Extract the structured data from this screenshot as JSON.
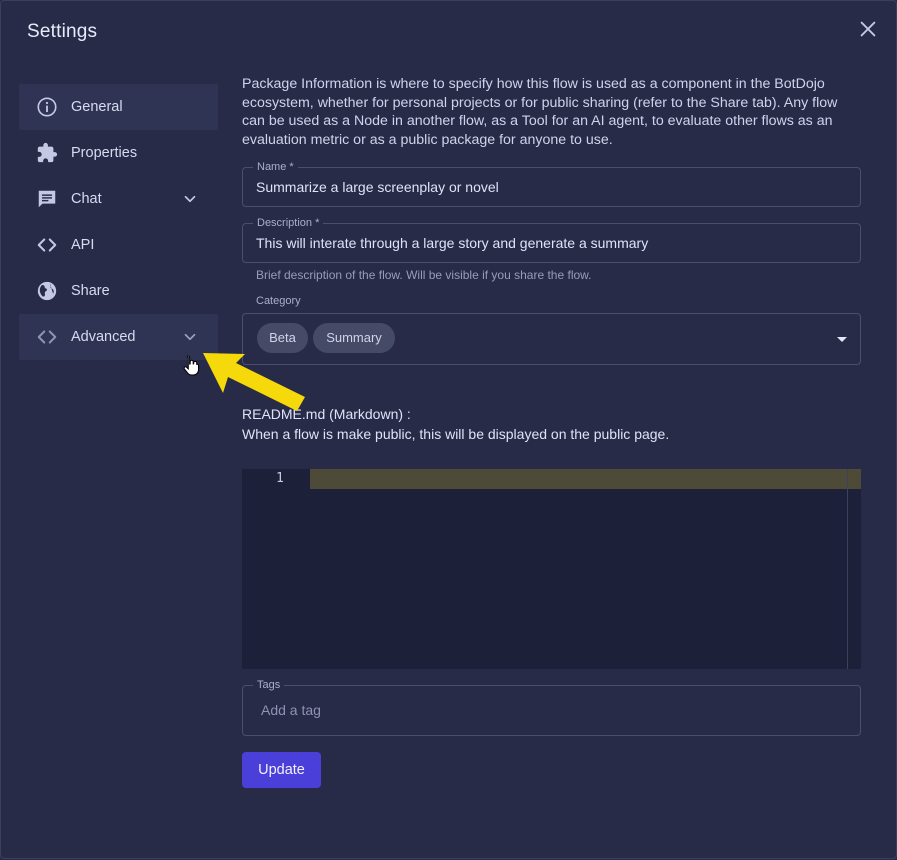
{
  "dialog": {
    "title": "Settings"
  },
  "sidebar": {
    "items": [
      {
        "label": "General",
        "icon": "info-icon"
      },
      {
        "label": "Properties",
        "icon": "puzzle-icon"
      },
      {
        "label": "Chat",
        "icon": "chat-icon",
        "expandable": true
      },
      {
        "label": "API",
        "icon": "code-icon"
      },
      {
        "label": "Share",
        "icon": "globe-icon"
      },
      {
        "label": "Advanced",
        "icon": "code-icon",
        "expandable": true
      }
    ]
  },
  "content": {
    "intro": "Package Information is where to specify how this flow is used as a component in the BotDojo ecosystem, whether for personal projects or for public sharing (refer to the Share tab). Any flow can be used as a Node in another flow, as a Tool for an AI agent, to evaluate other flows as an evaluation metric or as a public package for anyone to use.",
    "name": {
      "label": "Name *",
      "value": "Summarize a large screenplay or novel"
    },
    "description": {
      "label": "Description *",
      "value": "This will interate through a large story and generate a summary",
      "helper": "Brief description of the flow. Will be visible if you share the flow."
    },
    "category": {
      "label": "Category",
      "chips": [
        "Beta",
        "Summary"
      ]
    },
    "readme": {
      "heading": "README.md (Markdown) :",
      "description": "When a flow is make public, this will be displayed on the public page.",
      "line_number": "1"
    },
    "tags": {
      "label": "Tags",
      "placeholder": "Add a tag"
    },
    "update_label": "Update"
  },
  "colors": {
    "background": "#272b48",
    "sidebar_active": "#2f3454",
    "primary_button": "#4b3fd9",
    "annotation_arrow": "#f5d90a"
  }
}
